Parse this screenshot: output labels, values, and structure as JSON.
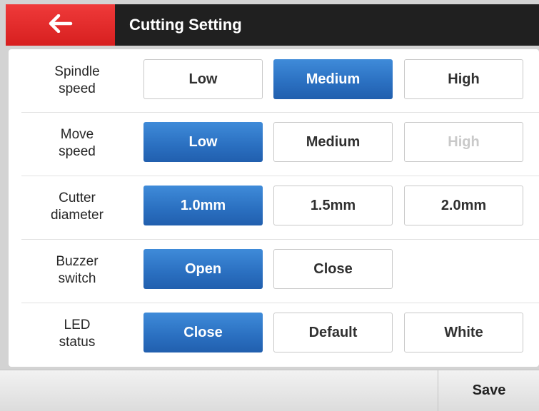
{
  "header": {
    "title": "Cutting Setting",
    "back_icon": "arrow-left-icon"
  },
  "colors": {
    "accent": "#2a6fc0",
    "back_button": "#e12b2b",
    "header_bg": "#202020"
  },
  "rows": [
    {
      "label_line1": "Spindle",
      "label_line2": "speed",
      "options": [
        {
          "label": "Low",
          "state": "normal"
        },
        {
          "label": "Medium",
          "state": "selected"
        },
        {
          "label": "High",
          "state": "normal"
        }
      ]
    },
    {
      "label_line1": "Move",
      "label_line2": "speed",
      "options": [
        {
          "label": "Low",
          "state": "selected"
        },
        {
          "label": "Medium",
          "state": "normal"
        },
        {
          "label": "High",
          "state": "disabled"
        }
      ]
    },
    {
      "label_line1": "Cutter",
      "label_line2": "diameter",
      "options": [
        {
          "label": "1.0mm",
          "state": "selected"
        },
        {
          "label": "1.5mm",
          "state": "normal"
        },
        {
          "label": "2.0mm",
          "state": "normal"
        }
      ]
    },
    {
      "label_line1": "Buzzer",
      "label_line2": "switch",
      "options": [
        {
          "label": "Open",
          "state": "selected"
        },
        {
          "label": "Close",
          "state": "normal"
        }
      ]
    },
    {
      "label_line1": "LED",
      "label_line2": "status",
      "options": [
        {
          "label": "Close",
          "state": "selected"
        },
        {
          "label": "Default",
          "state": "normal"
        },
        {
          "label": "White",
          "state": "normal"
        }
      ]
    }
  ],
  "footer": {
    "save_label": "Save"
  }
}
